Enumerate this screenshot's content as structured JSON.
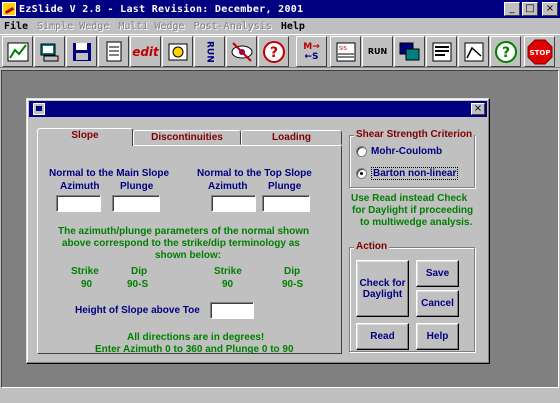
{
  "window": {
    "title": "EzSlide V 2.8 - Last Revision:  December, 2001",
    "minimize_glyph": "_",
    "maximize_glyph": "□",
    "close_glyph": "×"
  },
  "menu": [
    {
      "label": "File",
      "enabled": true
    },
    {
      "label": "Simple Wedge",
      "enabled": false
    },
    {
      "label": "Multi Wedge",
      "enabled": false
    },
    {
      "label": "Post-Analysis",
      "enabled": false
    },
    {
      "label": "Help",
      "enabled": true
    }
  ],
  "toolbar": {
    "run_text": "RUN",
    "edit_text": "edit",
    "m_text": "M→",
    "s_text": "←S",
    "help_glyph": "?",
    "stop_text": "STOP"
  },
  "dialog": {
    "close_glyph": "×",
    "tabs": [
      "Slope",
      "Discontinuities",
      "Loading"
    ],
    "slope_tab": {
      "normal_main_heading": "Normal to the Main Slope",
      "normal_top_heading": "Normal to the Top Slope",
      "azimuth_label": "Azimuth",
      "plunge_label": "Plunge",
      "note_line1": "The azimuth/plunge parameters of the normal shown",
      "note_line2": "above correspond to the strike/dip terminology as",
      "note_line3": "shown below:",
      "strike_label": "Strike",
      "dip_label": "Dip",
      "main_strike": "90",
      "main_dip": "90-S",
      "top_strike": "90",
      "top_dip": "90-S",
      "height_label": "Height of Slope above Toe",
      "footer_line1": "All directions are in degrees!",
      "footer_line2": "Enter Azimuth 0 to 360 and Plunge 0 to 90",
      "main_azimuth_value": "",
      "main_plunge_value": "",
      "top_azimuth_value": "",
      "top_plunge_value": "",
      "height_value": ""
    },
    "shear": {
      "title": "Shear Strength Criterion",
      "options": [
        "Mohr-Coulomb",
        "Barton non-linear"
      ],
      "selected": "Barton non-linear"
    },
    "hint_line1": "Use Read instead Check",
    "hint_line2": "for Daylight if proceeding",
    "hint_line3": "to multiwedge analysis.",
    "action": {
      "title": "Action",
      "check_line1": "Check for",
      "check_line2": "Daylight",
      "save": "Save",
      "cancel": "Cancel",
      "read": "Read",
      "help": "Help"
    }
  },
  "colors": {
    "titlebar": "#000080",
    "label_blue": "#000080",
    "note_green": "#008000",
    "tab_red": "#800000",
    "workspace": "#808080"
  }
}
